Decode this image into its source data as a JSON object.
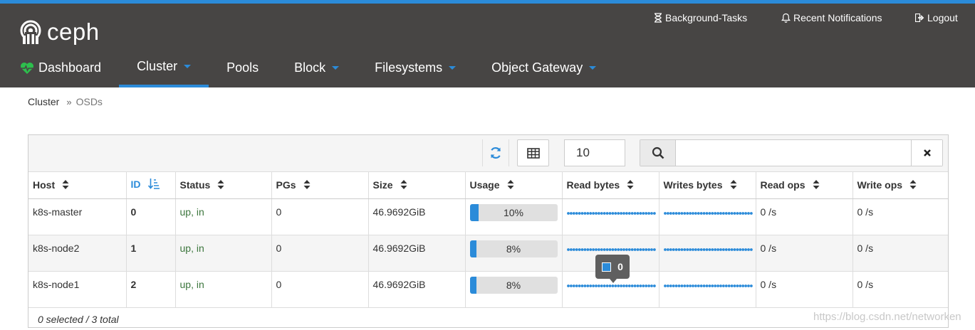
{
  "app": {
    "name": "ceph"
  },
  "header": {
    "background_tasks": "Background-Tasks",
    "notifications": "Recent Notifications",
    "logout": "Logout"
  },
  "nav": [
    {
      "label": "Dashboard",
      "icon": "heartbeat-icon",
      "dropdown": false,
      "active": false
    },
    {
      "label": "Cluster",
      "dropdown": true,
      "active": true
    },
    {
      "label": "Pools",
      "dropdown": false,
      "active": false
    },
    {
      "label": "Block",
      "dropdown": true,
      "active": false
    },
    {
      "label": "Filesystems",
      "dropdown": true,
      "active": false
    },
    {
      "label": "Object Gateway",
      "dropdown": true,
      "active": false
    }
  ],
  "breadcrumb": {
    "parent": "Cluster",
    "current": "OSDs"
  },
  "toolbar": {
    "page_size": "10",
    "search_value": "",
    "search_placeholder": ""
  },
  "table": {
    "columns": [
      "Host",
      "ID",
      "Status",
      "PGs",
      "Size",
      "Usage",
      "Read bytes",
      "Writes bytes",
      "Read ops",
      "Write ops"
    ],
    "sorted_column": "ID",
    "rows": [
      {
        "host": "k8s-master",
        "id": "0",
        "status": "up, in",
        "pgs": "0",
        "size": "46.9692GiB",
        "usage_label": "10%",
        "usage": 0.1,
        "read_ops": "0 /s",
        "write_ops": "0 /s"
      },
      {
        "host": "k8s-node2",
        "id": "1",
        "status": "up, in",
        "pgs": "0",
        "size": "46.9692GiB",
        "usage_label": "8%",
        "usage": 0.08,
        "read_ops": "0 /s",
        "write_ops": "0 /s"
      },
      {
        "host": "k8s-node1",
        "id": "2",
        "status": "up, in",
        "pgs": "0",
        "size": "46.9692GiB",
        "usage_label": "8%",
        "usage": 0.08,
        "read_ops": "0 /s",
        "write_ops": "0 /s"
      }
    ],
    "footer": "0 selected / 3 total"
  },
  "tooltip": {
    "value": "0"
  },
  "watermark": "https://blog.csdn.net/networken",
  "colors": {
    "accent": "#2b8bd9",
    "navbar": "#474544",
    "status_ok": "#3c763d",
    "heartbeat": "#2dbf4d"
  }
}
